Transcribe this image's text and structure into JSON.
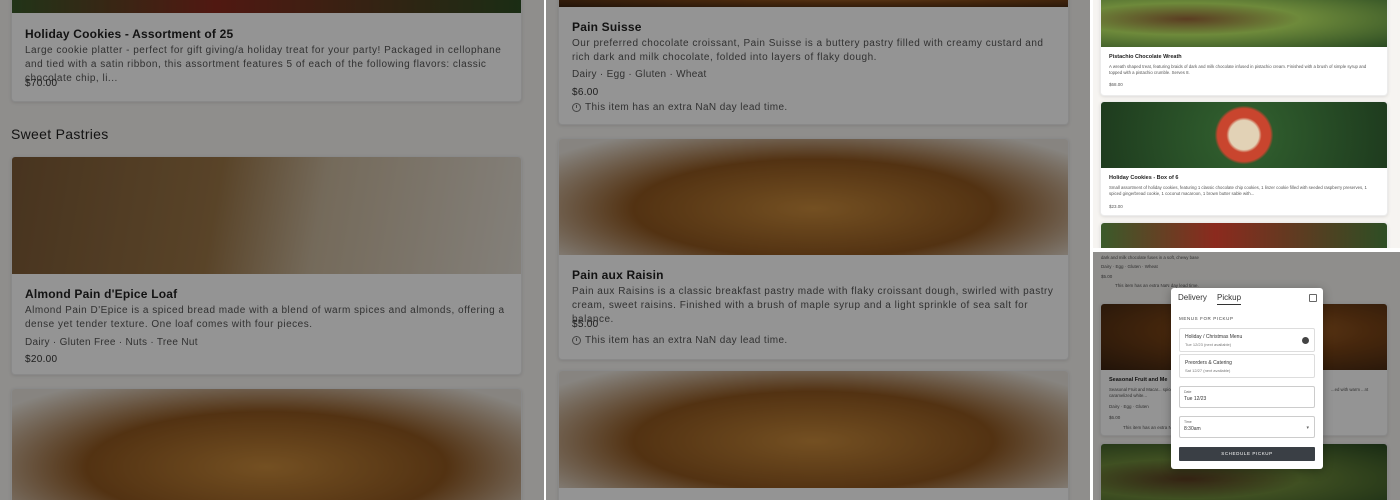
{
  "panel1": {
    "cookies25": {
      "title": "Holiday Cookies - Assortment of 25",
      "desc": "Large cookie platter - perfect for gift giving/a holiday treat for your party! Packaged in cellophane and tied with a satin ribbon, this assortment features 5 of each of the following flavors: classic chocolate chip, li...",
      "price": "$70.00"
    },
    "section": "Sweet Pastries",
    "almond": {
      "title": "Almond Pain d'Epice Loaf",
      "desc": "Almond Pain D'Epice is a spiced bread made with a blend of warm spices and almonds, offering a dense yet tender texture. One loaf comes with four pieces.",
      "tags": "Dairy · Gluten Free · Nuts · Tree Nut",
      "price": "$20.00"
    }
  },
  "panel2": {
    "suisse": {
      "title": "Pain Suisse",
      "desc": "Our preferred chocolate croissant, Pain Suisse is a buttery pastry filled with creamy custard and rich dark and milk chocolate, folded into layers of flaky dough.",
      "tags": "Dairy · Egg · Gluten · Wheat",
      "price": "$6.00",
      "lead": "This item has an extra NaN day lead time."
    },
    "raisin": {
      "title": "Pain aux Raisin",
      "desc": "Pain aux Raisins is a classic breakfast pastry made with flaky croissant dough, swirled with pastry cream, sweet raisins. Finished with a brush of maple syrup and a light sprinkle of sea salt for balance.",
      "price": "$5.00",
      "lead": "This item has an extra NaN day lead time."
    }
  },
  "panel3a": {
    "wreath": {
      "title": "Pistachio Chocolate Wreath",
      "desc": "A wreath shaped treat, featuring braids of dark and milk chocolate infused in pistachio cream. Finished with a brush of simple syrup and topped with a pistachio crumble. Serves 8.",
      "price": "$68.00"
    },
    "box6": {
      "title": "Holiday Cookies - Box of 6",
      "desc": "Small assortment of holiday cookies, featuring 1 classic chocolate chip cookies, 1 linzer cookie filled with seeded raspberry preserves, 1 spiced gingerbread cookie, 1 coconut macaroon, 1 brown butter sable with...",
      "price": "$23.00"
    }
  },
  "panel3b": {
    "top_desc": "dark and milk chocolate fuses in a soft, chewy base",
    "top_tags": "Dairy · Egg · Gluten · Wheat",
    "top_price": "$5.00",
    "top_lead": "This item has an extra NaN day lead time.",
    "seasonal": {
      "title": "Seasonal Fruit and Me",
      "desc": "Seasonal Fruit and Macar... spices, caramelized white...",
      "desc_right": "...ed with warm ...nt",
      "tags": "Dairy · Egg · Gluten",
      "price": "$6.00",
      "lead": "This item has an extra N..."
    },
    "modal": {
      "tab_delivery": "Delivery",
      "tab_pickup": "Pickup",
      "menus_label": "MENUS FOR PICKUP",
      "opt1_title": "Holiday / Christmas Menu",
      "opt1_sub": "Tue 12/23 (next available)",
      "opt2_title": "Preorders & Catering",
      "opt2_sub": "Sat 12/27 (next available)",
      "date_label": "Date",
      "date_value": "Tue 12/23",
      "time_label": "Time",
      "time_value": "8:30am",
      "button": "SCHEDULE PICKUP"
    }
  },
  "colors": {
    "overlay": "rgba(0,0,0,0.42)",
    "button": "#3a3f45"
  }
}
